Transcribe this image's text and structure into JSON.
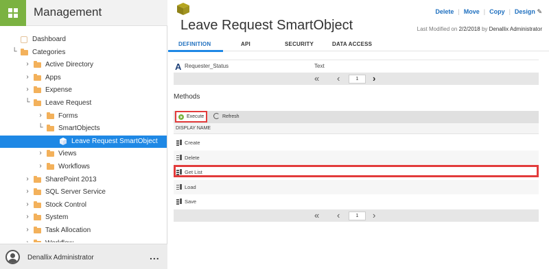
{
  "sidebar": {
    "title": "Management",
    "tree": [
      {
        "label": "Dashboard",
        "icon": "dashboard-icon",
        "level": 0,
        "arrow": ""
      },
      {
        "label": "Categories",
        "icon": "folder-icon",
        "level": 0,
        "arrow": "expanded"
      },
      {
        "label": "Active Directory",
        "icon": "folder-icon",
        "level": 1,
        "arrow": "collapsed"
      },
      {
        "label": "Apps",
        "icon": "folder-icon",
        "level": 1,
        "arrow": "collapsed"
      },
      {
        "label": "Expense",
        "icon": "folder-icon",
        "level": 1,
        "arrow": "collapsed"
      },
      {
        "label": "Leave Request",
        "icon": "folder-icon",
        "level": 1,
        "arrow": "expanded"
      },
      {
        "label": "Forms",
        "icon": "folder-icon",
        "level": 2,
        "arrow": "collapsed"
      },
      {
        "label": "SmartObjects",
        "icon": "folder-icon",
        "level": 2,
        "arrow": "expanded"
      },
      {
        "label": "Leave Request SmartObject",
        "icon": "smartobject-icon",
        "level": 3,
        "arrow": "",
        "selected": true
      },
      {
        "label": "Views",
        "icon": "folder-icon",
        "level": 2,
        "arrow": "collapsed"
      },
      {
        "label": "Workflows",
        "icon": "folder-icon",
        "level": 2,
        "arrow": "collapsed"
      },
      {
        "label": "SharePoint 2013",
        "icon": "folder-icon",
        "level": 1,
        "arrow": "collapsed"
      },
      {
        "label": "SQL Server Service",
        "icon": "folder-icon",
        "level": 1,
        "arrow": "collapsed"
      },
      {
        "label": "Stock Control",
        "icon": "folder-icon",
        "level": 1,
        "arrow": "collapsed"
      },
      {
        "label": "System",
        "icon": "folder-icon",
        "level": 1,
        "arrow": "collapsed"
      },
      {
        "label": "Task Allocation",
        "icon": "folder-icon",
        "level": 1,
        "arrow": "collapsed"
      },
      {
        "label": "Workflow",
        "icon": "folder-icon",
        "level": 1,
        "arrow": "collapsed"
      }
    ],
    "footer": {
      "user": "Denallix Administrator",
      "more": "..."
    }
  },
  "main": {
    "actions": {
      "delete": "Delete",
      "move": "Move",
      "copy": "Copy",
      "design": "Design"
    },
    "title": "Leave Request SmartObject",
    "modified_prefix": "Last Modified on",
    "modified_date": "2/2/2018",
    "modified_by_prefix": "by",
    "modified_by": "Denallix Administrator",
    "tabs": [
      "DEFINITION",
      "API",
      "SECURITY",
      "DATA ACCESS"
    ],
    "active_tab": "DEFINITION",
    "property_row": {
      "name": "Requester_Status",
      "type": "Text"
    },
    "pager_page": "1",
    "methods_title": "Methods",
    "toolbar": {
      "execute": "Execute",
      "refresh": "Refresh"
    },
    "column_header": "DISPLAY NAME",
    "methods": [
      {
        "name": "Create"
      },
      {
        "name": "Delete"
      },
      {
        "name": "Get List",
        "highlighted": true
      },
      {
        "name": "Load"
      },
      {
        "name": "Save"
      }
    ]
  },
  "colors": {
    "accent": "#1e88e5",
    "brand_green": "#7bb241",
    "highlight_red": "#e23b3b",
    "folder": "#f3b15b"
  }
}
